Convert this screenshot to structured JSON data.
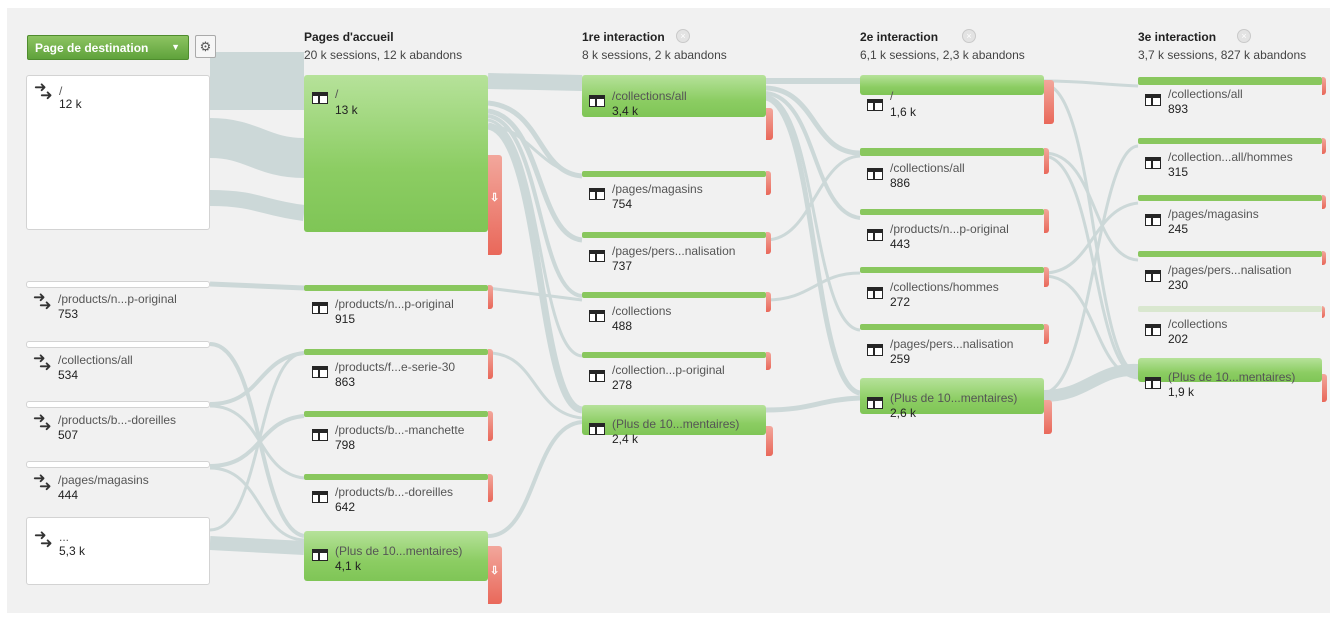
{
  "controls": {
    "dimension_select": "Page de destination",
    "settings_icon": "gear-icon",
    "close_icon": "circle-x-icon"
  },
  "colors": {
    "node_green": "#8ccd63",
    "dropoff_red": "#e9685a",
    "flow_gray": "#ccd8d8",
    "background": "#f1f1f1"
  },
  "columns": [
    {
      "title": "Pages d'accueil",
      "subtitle": "20 k sessions, 12 k abandons"
    },
    {
      "title": "1re interaction",
      "subtitle": "8 k sessions, 2 k abandons"
    },
    {
      "title": "2e interaction",
      "subtitle": "6,1 k sessions, 2,3 k abandons"
    },
    {
      "title": "3e interaction",
      "subtitle": "3,7 k sessions, 827 k abandons"
    }
  ],
  "start_nodes": [
    {
      "label": "/",
      "value": "12 k"
    },
    {
      "label": "/products/n...p-original",
      "value": "753"
    },
    {
      "label": "/collections/all",
      "value": "534"
    },
    {
      "label": "/products/b...-doreilles",
      "value": "507"
    },
    {
      "label": "/pages/magasins",
      "value": "444"
    },
    {
      "label": "...",
      "value": "5,3 k"
    }
  ],
  "landing_pages": [
    {
      "label": "/",
      "value": "13 k"
    },
    {
      "label": "/products/n...p-original",
      "value": "915"
    },
    {
      "label": "/products/f...e-serie-30",
      "value": "863"
    },
    {
      "label": "/products/b...-manchette",
      "value": "798"
    },
    {
      "label": "/products/b...-doreilles",
      "value": "642"
    },
    {
      "label": "(Plus de 10...mentaires)",
      "value": "4,1 k"
    }
  ],
  "interaction_1": [
    {
      "label": "/collections/all",
      "value": "3,4 k"
    },
    {
      "label": "/pages/magasins",
      "value": "754"
    },
    {
      "label": "/pages/pers...nalisation",
      "value": "737"
    },
    {
      "label": "/collections",
      "value": "488"
    },
    {
      "label": "/collection...p-original",
      "value": "278"
    },
    {
      "label": "(Plus de 10...mentaires)",
      "value": "2,4 k"
    }
  ],
  "interaction_2": [
    {
      "label": "/",
      "value": "1,6 k"
    },
    {
      "label": "/collections/all",
      "value": "886"
    },
    {
      "label": "/products/n...p-original",
      "value": "443"
    },
    {
      "label": "/collections/hommes",
      "value": "272"
    },
    {
      "label": "/pages/pers...nalisation",
      "value": "259"
    },
    {
      "label": "(Plus de 10...mentaires)",
      "value": "2,6 k"
    }
  ],
  "interaction_3": [
    {
      "label": "/collections/all",
      "value": "893"
    },
    {
      "label": "/collection...all/hommes",
      "value": "315"
    },
    {
      "label": "/pages/magasins",
      "value": "245"
    },
    {
      "label": "/pages/pers...nalisation",
      "value": "230"
    },
    {
      "label": "/collections",
      "value": "202"
    },
    {
      "label": "(Plus de 10...mentaires)",
      "value": "1,9 k"
    }
  ]
}
